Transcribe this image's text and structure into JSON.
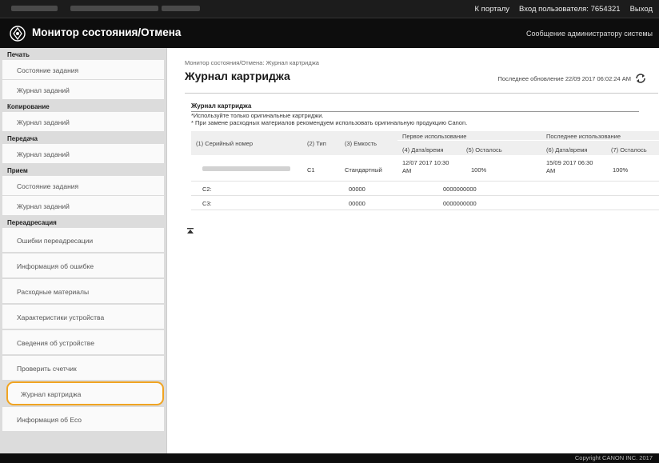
{
  "topbar": {
    "portal_link": "К порталу",
    "login_label": "Вход пользователя:",
    "login_value": "7654321",
    "logout": "Выход"
  },
  "app": {
    "title": "Монитор состояния/Отмена",
    "admin_message": "Сообщение администратору системы"
  },
  "sidebar": {
    "sections": [
      {
        "head": "Печать",
        "items": [
          "Состояние задания",
          "Журнал заданий"
        ]
      },
      {
        "head": "Копирование",
        "items": [
          "Журнал заданий"
        ]
      },
      {
        "head": "Передача",
        "items": [
          "Журнал заданий"
        ]
      },
      {
        "head": "Прием",
        "items": [
          "Состояние задания",
          "Журнал заданий"
        ]
      },
      {
        "head": "Переадресация",
        "items": [
          "Ошибки переадресации",
          "Информация об ошибке",
          "Расходные материалы",
          "Характеристики устройства",
          "Сведения об устройстве",
          "Проверить счетчик",
          "Журнал картриджа",
          "Информация об Eco"
        ]
      }
    ],
    "active_item": "Журнал картриджа"
  },
  "main": {
    "breadcrumb": "Монитор состояния/Отмена: Журнал картриджа",
    "title": "Журнал картриджа",
    "last_update": "Последнее обновление 22/09 2017 06:02:24 AM",
    "section_title": "Журнал картриджа",
    "notes": [
      "*Используйте только оригинальные картриджи.",
      "* При замене расходных материалов рекомендуем использовать оригинальную продукцию Canon."
    ],
    "table": {
      "headers": {
        "serial": "(1) Серийный номер",
        "type": "(2) Тип",
        "capacity": "(3) Емкость",
        "first_use": "Первое использование",
        "last_use": "Последнее использование",
        "first_dt": "(4) Дата/время",
        "first_rem": "(5) Осталось",
        "last_dt": "(6) Дата/время",
        "last_rem": "(7) Осталось"
      },
      "rows": [
        {
          "type": "C1",
          "capacity": "Стандартный",
          "first_dt": "12/07 2017 10:30 AM",
          "first_rem": "100%",
          "last_dt": "15/09 2017 06:30 AM",
          "last_rem": "100%"
        }
      ],
      "extra_rows": [
        {
          "label": "C2:",
          "capacity": "00000",
          "value": "0000000000"
        },
        {
          "label": "C3:",
          "capacity": "00000",
          "value": "0000000000"
        }
      ]
    }
  },
  "footer": {
    "copyright": "Copyright CANON INC. 2017"
  },
  "colors": {
    "active_outline": "#f0a422",
    "topbar": "#1c1c1c",
    "appbar": "#0d0d0d",
    "sidebar": "#dcdcdc"
  }
}
